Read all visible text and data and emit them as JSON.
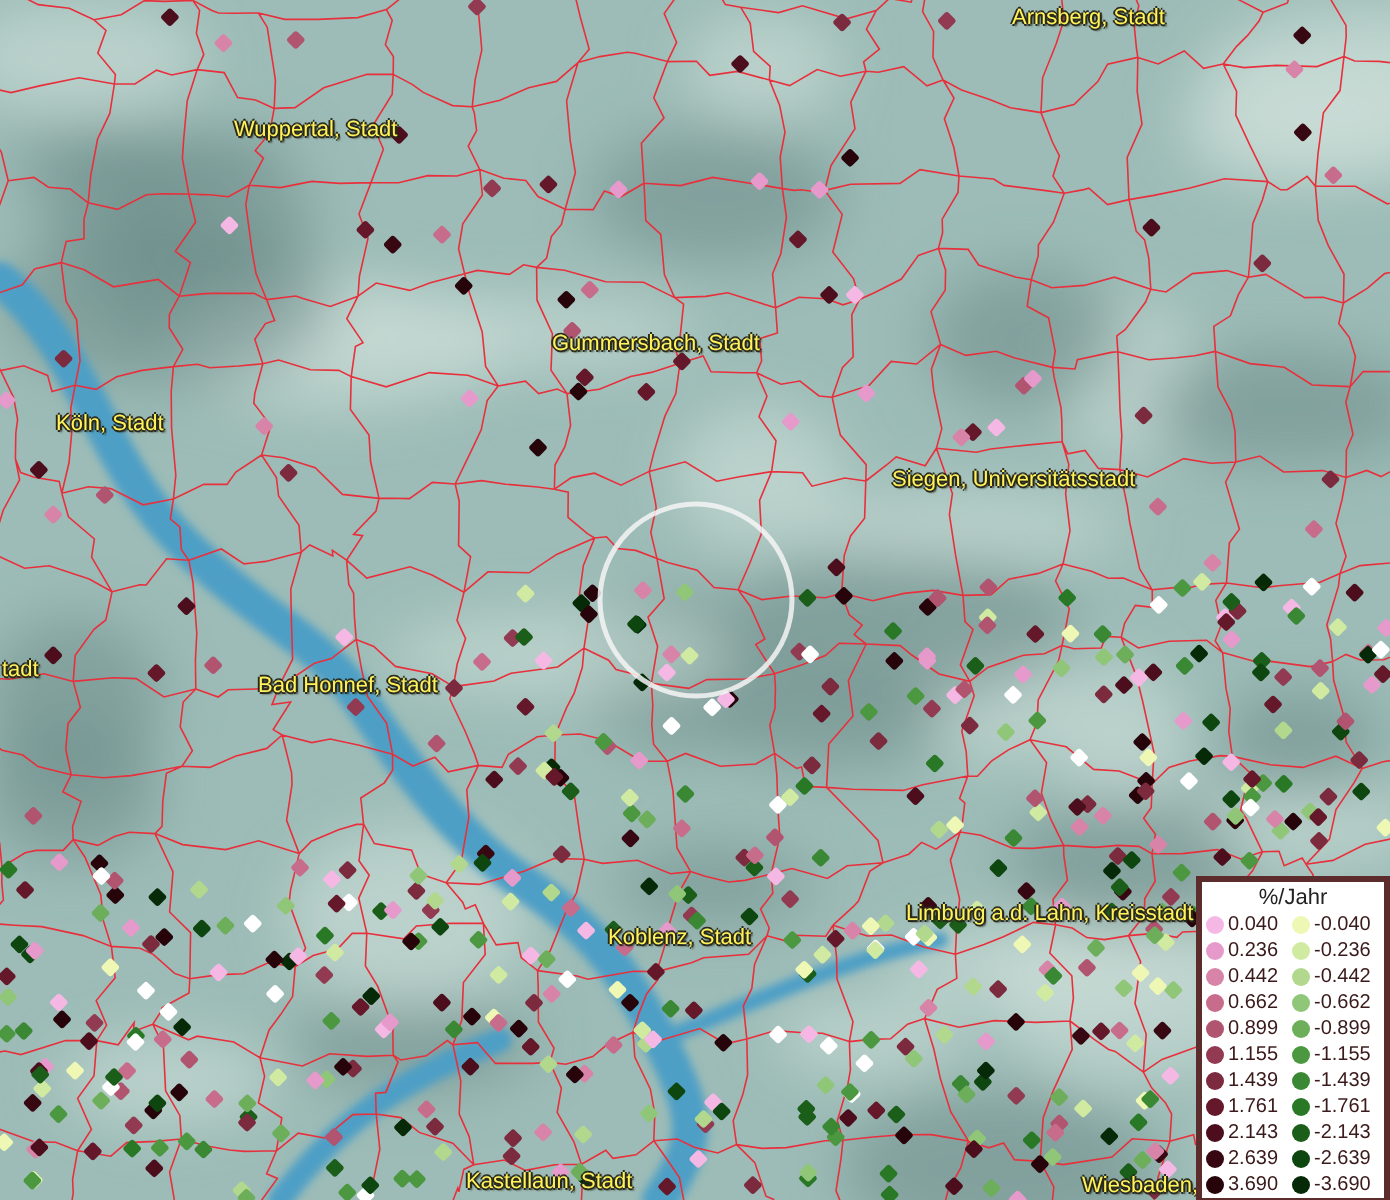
{
  "map_labels": [
    {
      "text": "Arnsberg, Stadt"
    },
    {
      "text": "Wuppertal, Stadt"
    },
    {
      "text": "Gummersbach, Stadt"
    },
    {
      "text": "Köln, Stadt"
    },
    {
      "text": "Siegen, Universitätsstadt"
    },
    {
      "text": "tadt"
    },
    {
      "text": "Bad Honnef, Stadt"
    },
    {
      "text": "Limburg a.d. Lahn, Kreisstadt"
    },
    {
      "text": "Koblenz, Stadt"
    },
    {
      "text": "Kastellaun, Stadt"
    },
    {
      "text": "Wiesbaden,"
    }
  ],
  "legend": {
    "title": "%/Jahr",
    "left_column": [
      {
        "value": "0.040",
        "color": "#f5b8e4"
      },
      {
        "value": "0.236",
        "color": "#e69acb"
      },
      {
        "value": "0.442",
        "color": "#d884a8"
      },
      {
        "value": "0.662",
        "color": "#c86c8c"
      },
      {
        "value": "0.899",
        "color": "#b05470"
      },
      {
        "value": "1.155",
        "color": "#923a52"
      },
      {
        "value": "1.439",
        "color": "#7c2a3e"
      },
      {
        "value": "1.761",
        "color": "#64182a"
      },
      {
        "value": "2.143",
        "color": "#4c0e1c"
      },
      {
        "value": "2.639",
        "color": "#380812"
      },
      {
        "value": "3.690",
        "color": "#26040a"
      }
    ],
    "right_column": [
      {
        "value": "-0.040",
        "color": "#eef8b4"
      },
      {
        "value": "-0.236",
        "color": "#d0eaa2"
      },
      {
        "value": "-0.442",
        "color": "#b2d88e"
      },
      {
        "value": "-0.662",
        "color": "#90c678"
      },
      {
        "value": "-0.899",
        "color": "#6cae5a"
      },
      {
        "value": "-1.155",
        "color": "#4c9840"
      },
      {
        "value": "-1.439",
        "color": "#3a8834"
      },
      {
        "value": "-1.761",
        "color": "#287826"
      },
      {
        "value": "-2.143",
        "color": "#1a5e1a"
      },
      {
        "value": "-2.639",
        "color": "#0e4610"
      },
      {
        "value": "-3.690",
        "color": "#062a08"
      }
    ]
  }
}
